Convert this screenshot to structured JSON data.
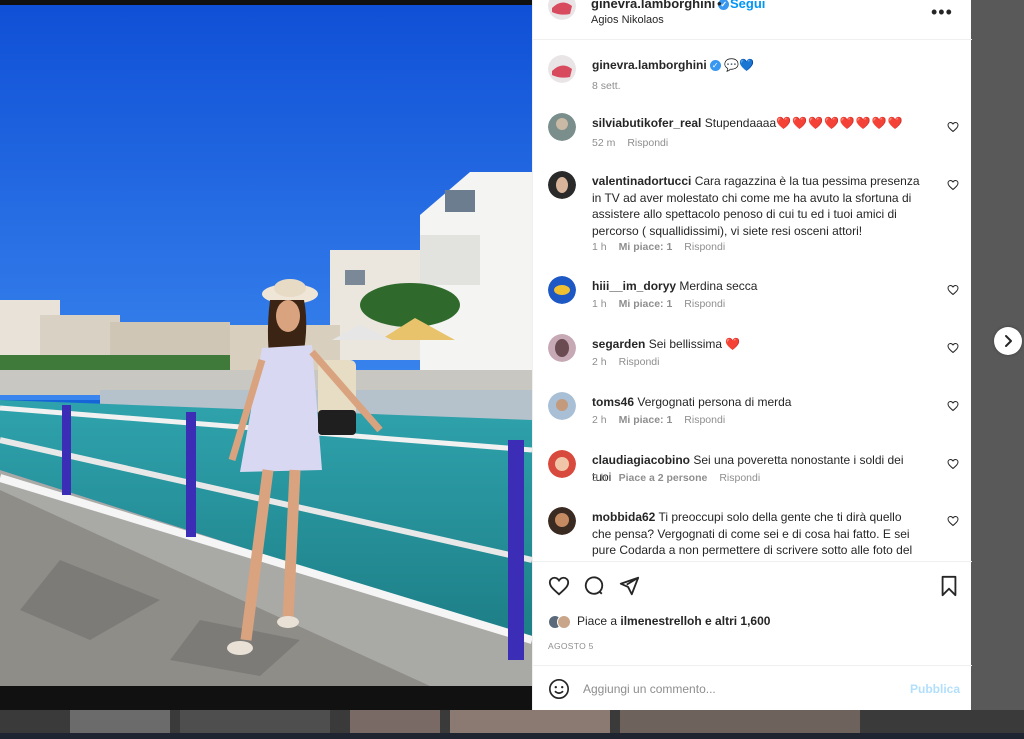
{
  "post": {
    "username": "ginevra.lamborghini",
    "follow_label": "Segui",
    "dot": "•",
    "location": "Agios Nikolaos",
    "more_label": "•••",
    "caption_emoji": "💬💙",
    "caption_time": "8 sett."
  },
  "comments": [
    {
      "user": "silviabutikofer_real",
      "text": "Stupendaaaa",
      "hearts": "❤️❤️❤️❤️❤️❤️❤️❤️",
      "time": "52 m",
      "likes": "",
      "reply": "Rispondi"
    },
    {
      "user": "valentinadortucci",
      "text": "Cara ragazzina è la tua pessima presenza in TV ad aver molestato chi come me ha avuto la sfortuna di assistere allo spettacolo penoso di cui tu ed i tuoi amici di percorso ( squallidissimi), vi siete resi osceni attori!",
      "time": "1 h",
      "likes": "Mi piace: 1",
      "reply": "Rispondi"
    },
    {
      "user": "hiii__im_doryy",
      "text": "Merdina secca",
      "time": "1 h",
      "likes": "Mi piace: 1",
      "reply": "Rispondi"
    },
    {
      "user": "segarden",
      "text": "Sei bellissima",
      "hearts": "❤️",
      "time": "2 h",
      "likes": "",
      "reply": "Rispondi"
    },
    {
      "user": "toms46",
      "text": "Vergognati persona di merda",
      "time": "2 h",
      "likes": "Mi piace: 1",
      "reply": "Rispondi"
    },
    {
      "user": "claudiagiacobino",
      "text": "Sei una poveretta nonostante i soldi dei tuoi",
      "time": "3 h",
      "likes": "Piace a 2 persone",
      "reply": "Rispondi"
    },
    {
      "user": "mobbida62",
      "text": "Ti preoccupi solo della gente che ti dirà quello che pensa? Vergognati di come sei e di cosa hai fatto. E sei pure Codarda a non permettere di scrivere sotto alle foto del GF.",
      "time": "",
      "likes": "",
      "reply": ""
    }
  ],
  "likes_line": {
    "prefix": "Piace a ",
    "user": "ilmenestrelloh",
    "suffix": " e altri 1,600"
  },
  "date": "AGOSTO 5",
  "comment_input": {
    "placeholder": "Aggiungi un commento...",
    "publish": "Pubblica"
  },
  "colors": {
    "accent": "#0095f6",
    "heart": "#e0102f",
    "sky": "#1565d8",
    "water": "#2a9aa6"
  }
}
